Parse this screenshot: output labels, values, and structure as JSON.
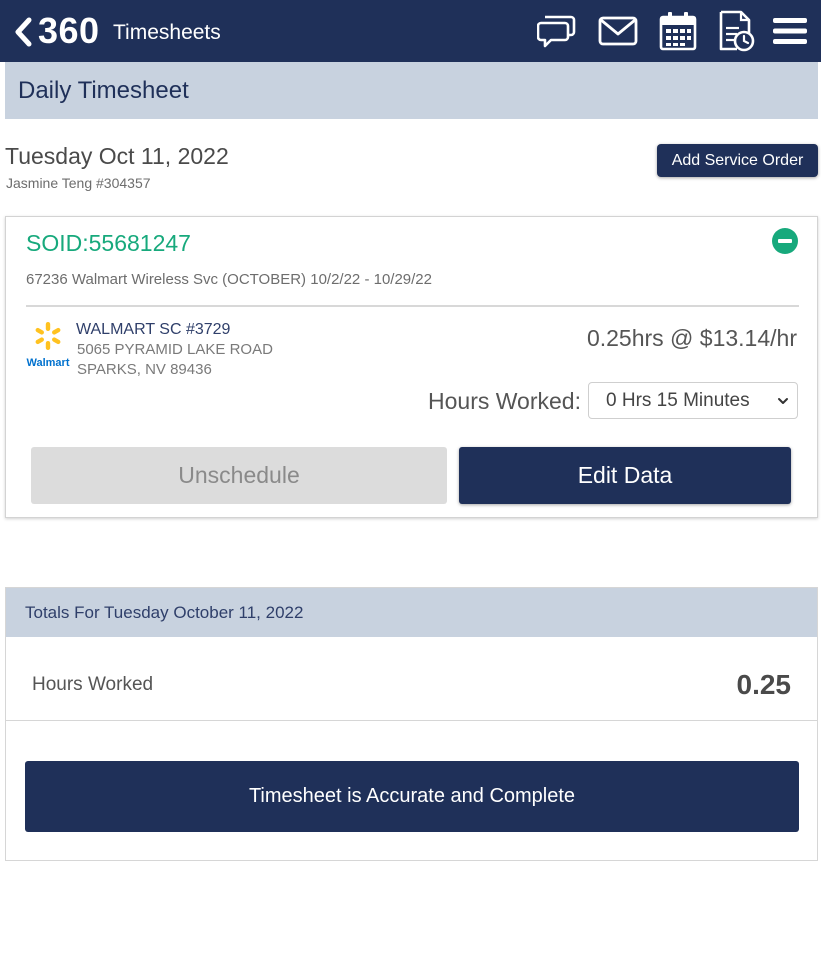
{
  "header": {
    "brand": "360",
    "title": "Timesheets",
    "icons": [
      "back-chevron-icon",
      "chat-icon",
      "mail-icon",
      "calendar-icon",
      "timesheet-clock-icon",
      "hamburger-menu-icon"
    ]
  },
  "page": {
    "title": "Daily Timesheet",
    "date": "Tuesday Oct 11, 2022",
    "employee": "Jasmine Teng #304357",
    "add_service_order_label": "Add Service Order"
  },
  "service_order": {
    "soid": "SOID:55681247",
    "description": "67236 Walmart Wireless Svc (OCTOBER) 10/2/22 - 10/29/22",
    "store": {
      "logo_text": "Walmart",
      "name": "WALMART SC #3729",
      "address_line1": "5065 PYRAMID LAKE ROAD",
      "address_line2": "SPARKS, NV 89436"
    },
    "rate": "0.25hrs @ $13.14/hr",
    "hours_worked_label": "Hours Worked:",
    "hours_worked_value": "0 Hrs 15 Minutes",
    "unschedule_label": "Unschedule",
    "edit_label": "Edit Data"
  },
  "totals": {
    "header": "Totals For Tuesday October 11, 2022",
    "hours_label": "Hours Worked",
    "hours_value": "0.25",
    "complete_label": "Timesheet is Accurate and Complete"
  },
  "colors": {
    "navy": "#1f3059",
    "header_bg": "#c8d2df",
    "green": "#17a97c",
    "walmart_blue": "#0071ce",
    "walmart_yellow": "#ffc220"
  }
}
